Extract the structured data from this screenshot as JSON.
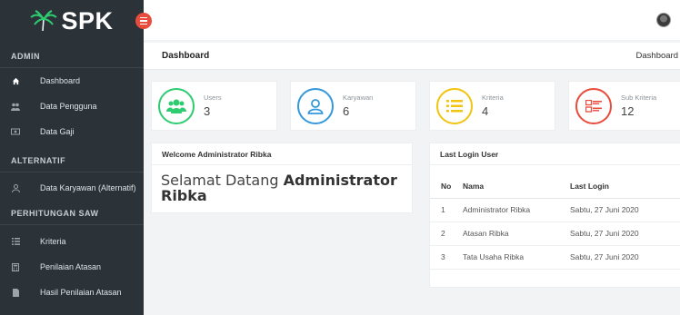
{
  "brand": {
    "name": "SPK"
  },
  "sidebar": {
    "sections": [
      {
        "title": "ADMIN",
        "items": [
          {
            "label": "Dashboard",
            "icon": "home-icon"
          },
          {
            "label": "Data Pengguna",
            "icon": "users-icon"
          },
          {
            "label": "Data Gaji",
            "icon": "money-icon"
          }
        ]
      },
      {
        "title": "ALTERNATIF",
        "items": [
          {
            "label": "Data Karyawan (Alternatif)",
            "icon": "user-icon"
          }
        ]
      },
      {
        "title": "PERHITUNGAN SAW",
        "items": [
          {
            "label": "Kriteria",
            "icon": "list-icon"
          },
          {
            "label": "Penilaian Atasan",
            "icon": "calculator-icon"
          },
          {
            "label": "Hasil Penilaian Atasan",
            "icon": "file-icon"
          }
        ]
      }
    ]
  },
  "header": {
    "page_title": "Dashboard",
    "breadcrumb": "Dashboard"
  },
  "stats": [
    {
      "label": "Users",
      "value": "3",
      "color": "#2ecc71",
      "icon": "users-icon"
    },
    {
      "label": "Karyawan",
      "value": "6",
      "color": "#3498db",
      "icon": "user-icon"
    },
    {
      "label": "Kriteria",
      "value": "4",
      "color": "#f1c40f",
      "icon": "list-icon"
    },
    {
      "label": "Sub Kriteria",
      "value": "12",
      "color": "#e74c3c",
      "icon": "sublist-icon"
    }
  ],
  "welcome": {
    "heading": "Welcome Administrator Ribka",
    "text_prefix": "Selamat Datang ",
    "text_name": "Administrator Ribka"
  },
  "last_login": {
    "heading": "Last Login User",
    "columns": [
      "No",
      "Nama",
      "Last Login"
    ],
    "rows": [
      [
        "1",
        "Administrator Ribka",
        "Sabtu, 27 Juni 2020"
      ],
      [
        "2",
        "Atasan Ribka",
        "Sabtu, 27 Juni 2020"
      ],
      [
        "3",
        "Tata Usaha Ribka",
        "Sabtu, 27 Juni 2020"
      ]
    ]
  }
}
